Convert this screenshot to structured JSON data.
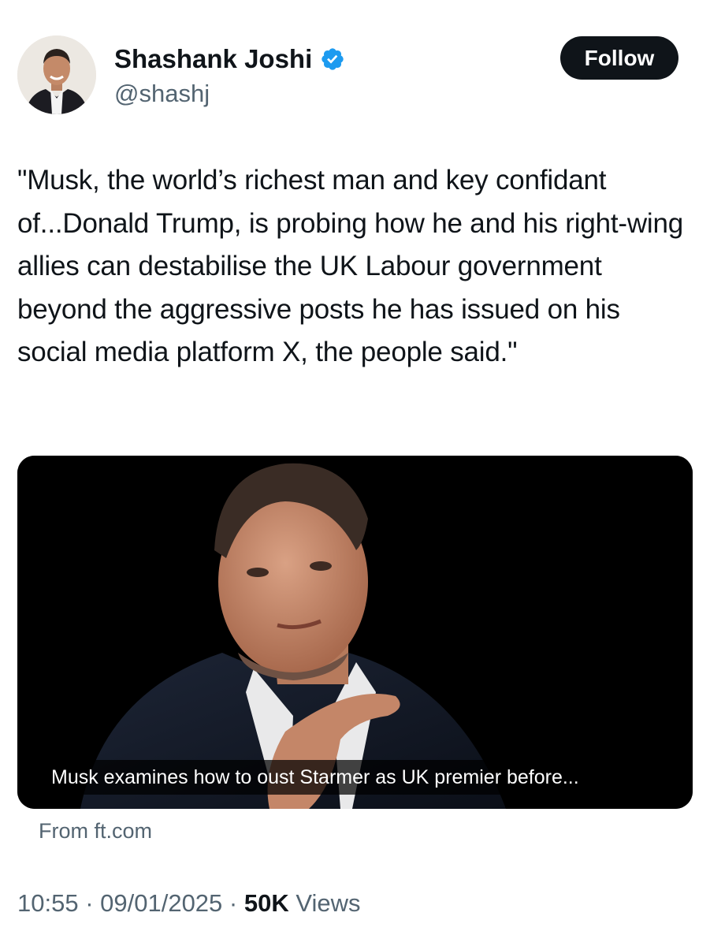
{
  "author": {
    "name": "Shashank Joshi",
    "handle": "@shashj",
    "verified_color": "#1d9bf0"
  },
  "actions": {
    "follow_label": "Follow"
  },
  "tweet": {
    "text": "\"Musk, the world’s richest man and key confidant of...Donald Trump, is probing how he and his right-wing allies can destabilise the UK Labour government beyond the aggressive posts he has issued on his social media platform X, the people said.\""
  },
  "link_card": {
    "headline": "Musk examines how to oust Starmer as UK premier before...",
    "source": "From ft.com"
  },
  "meta": {
    "time": "10:55",
    "sep1": " · ",
    "date": "09/01/2025",
    "sep2": " · ",
    "views_count": "50K",
    "views_label": " Views"
  },
  "colors": {
    "text_primary": "#0f1419",
    "text_secondary": "#536471",
    "button_bg": "#0f1419",
    "accent": "#1d9bf0"
  },
  "icons": {
    "verified": "verified-badge-icon"
  }
}
